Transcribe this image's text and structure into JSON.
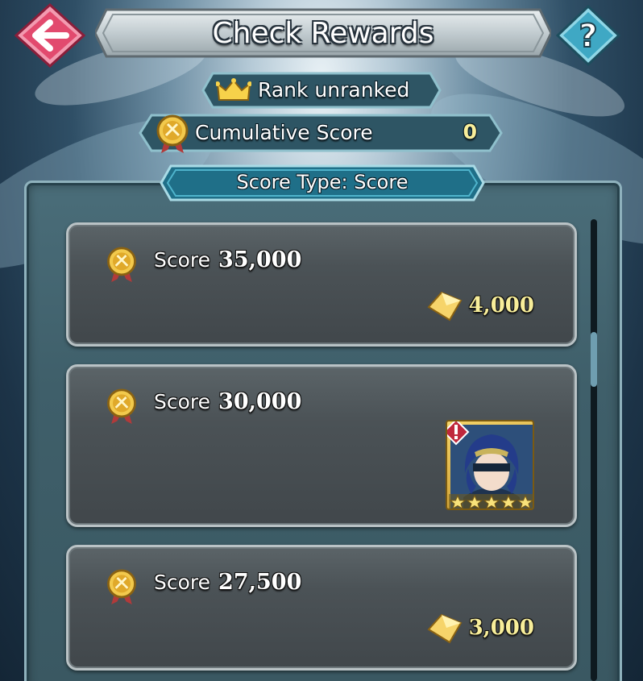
{
  "header": {
    "title": "Check Rewards",
    "back_icon": "back-arrow-icon",
    "help_icon": "question-mark-icon"
  },
  "rank": {
    "label": "Rank unranked",
    "icon": "crown-icon"
  },
  "cumulative": {
    "label": "Cumulative Score",
    "value": "0",
    "icon": "score-medal-icon"
  },
  "score_type": {
    "label": "Score Type: Score"
  },
  "colors": {
    "back_button": "#e24a6e",
    "help_button": "#3fa8c4",
    "reward_value": "#f8ee9a",
    "panel": "#3f5f6a"
  },
  "rewards": [
    {
      "score_label": "Score",
      "score_value": "35,000",
      "reward_type": "orb-icon",
      "reward_value": "4,000"
    },
    {
      "score_label": "Score",
      "score_value": "30,000",
      "reward_type": "hero-portrait",
      "reward_rarity_stars": 5
    },
    {
      "score_label": "Score",
      "score_value": "27,500",
      "reward_type": "orb-icon",
      "reward_value": "3,000"
    }
  ]
}
